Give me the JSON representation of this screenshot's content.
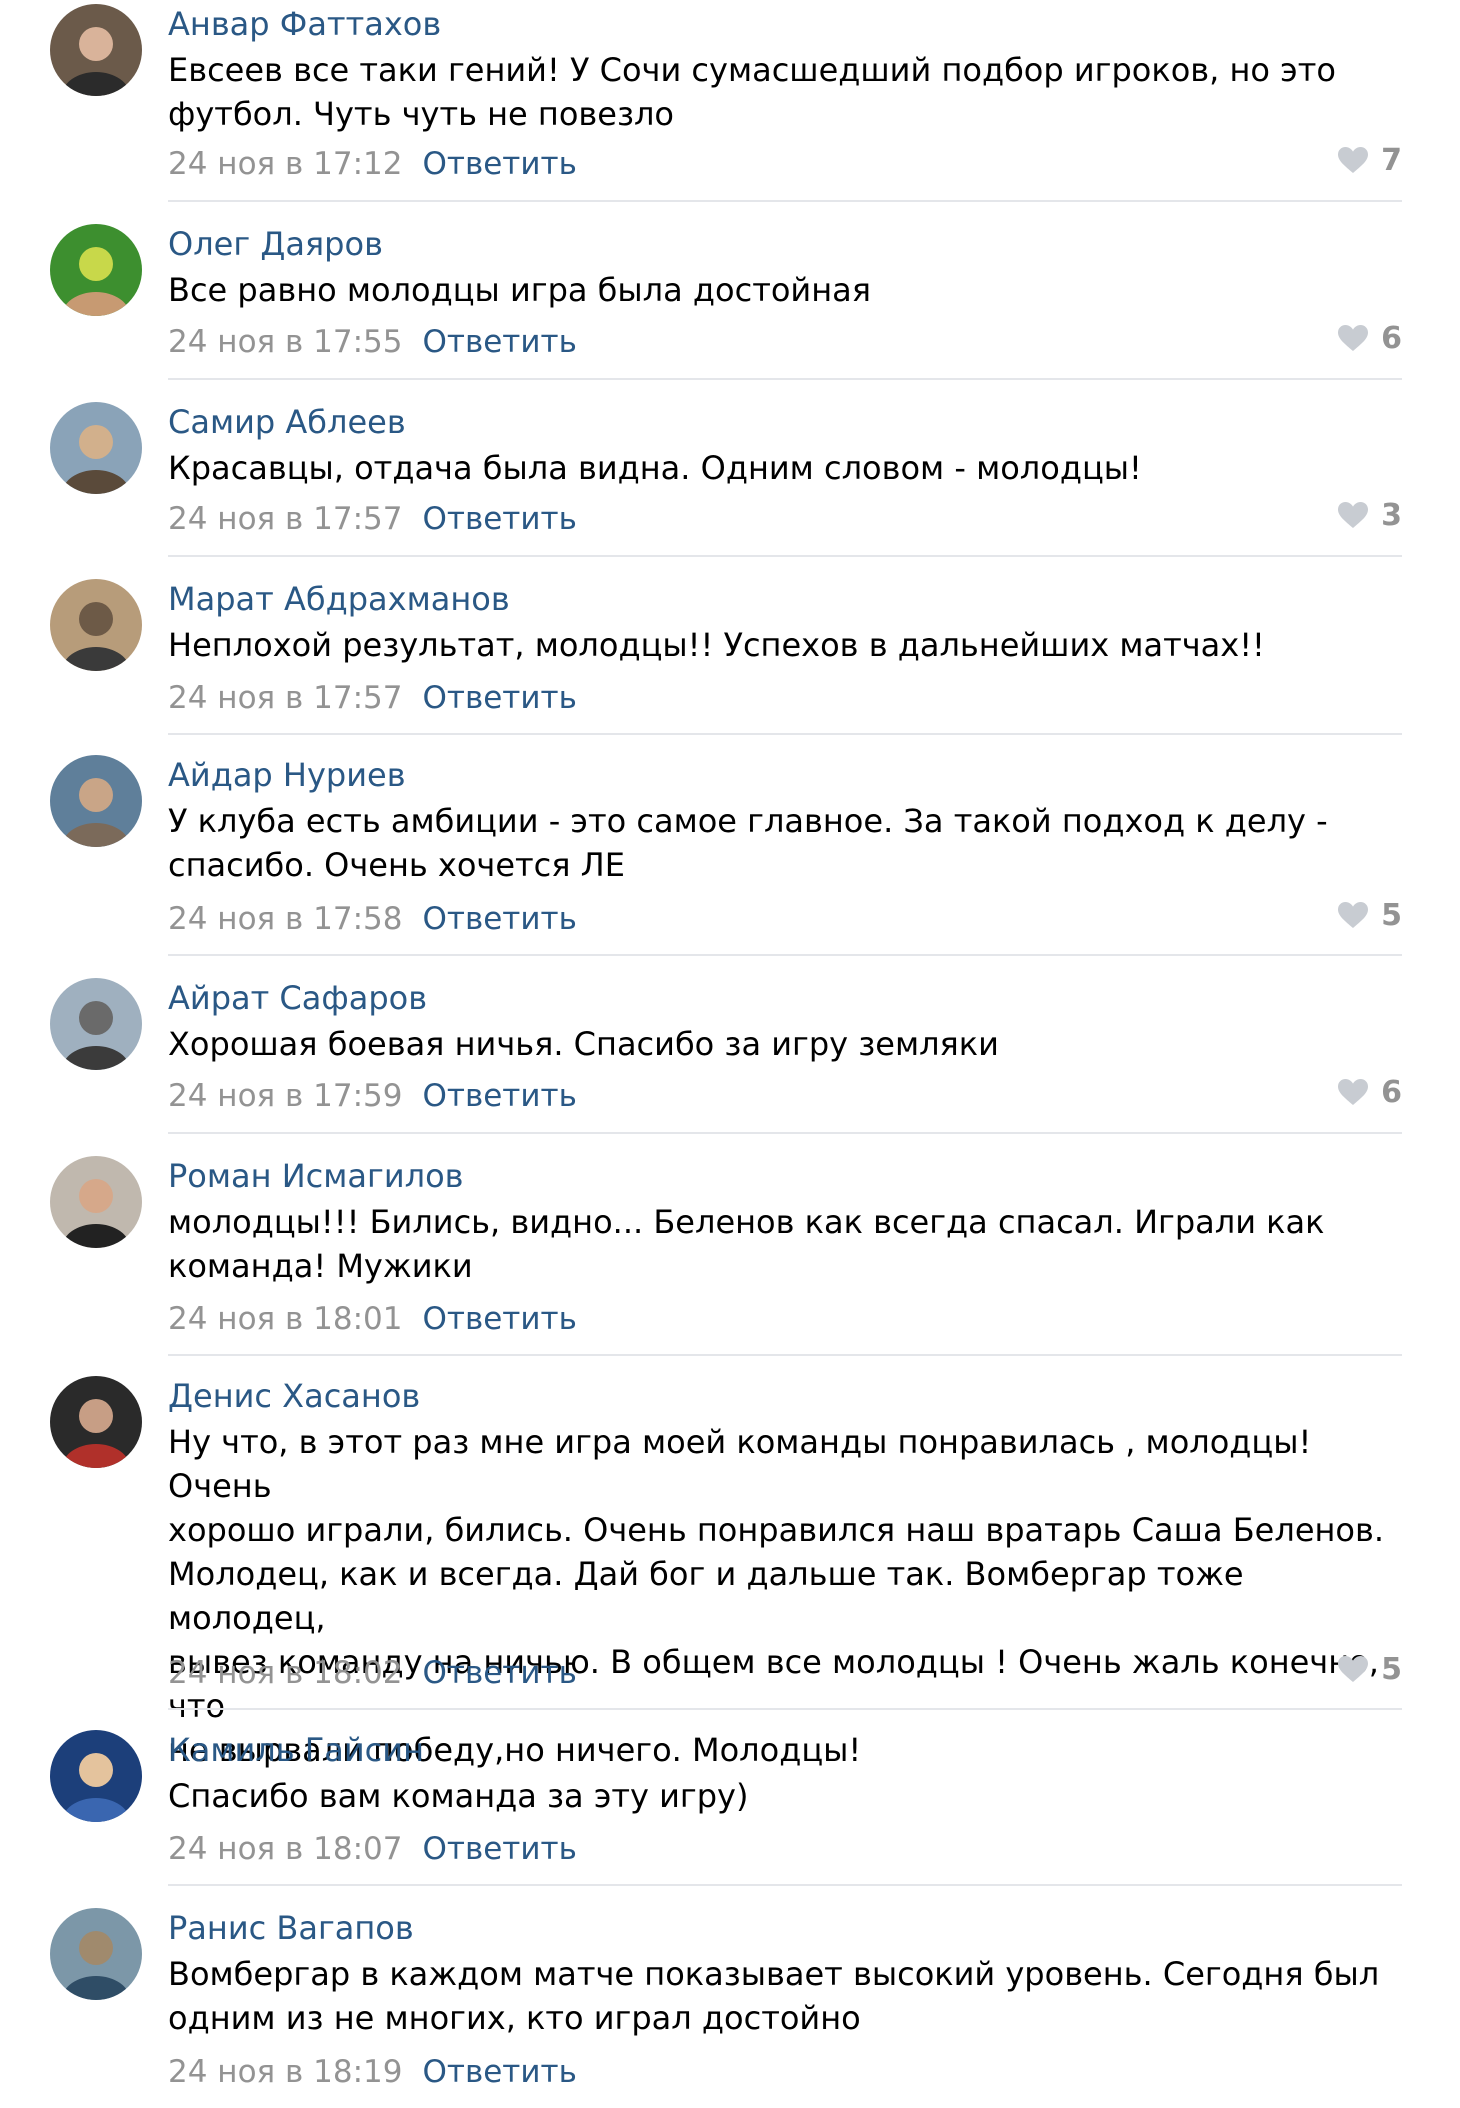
{
  "reply_label": "Ответить",
  "colors": {
    "link": "#2a5885",
    "muted": "#939393",
    "divider": "#e4e6ea"
  },
  "icons": {
    "like": "heart-icon"
  },
  "comments": [
    {
      "author": "Анвар Фаттахов",
      "text": "Евсеев все таки гений! У Сочи сумасшедший подбор игроков, но это\nфутбол. Чуть чуть не повезло",
      "date": "24 ноя в 17:12",
      "likes": "7"
    },
    {
      "author": "Олег Даяров",
      "text": "Все равно молодцы игра была достойная",
      "date": "24 ноя в 17:55",
      "likes": "6"
    },
    {
      "author": "Самир Аблеев",
      "text": "Красавцы, отдача была видна. Одним словом - молодцы!",
      "date": "24 ноя в 17:57",
      "likes": "3"
    },
    {
      "author": "Марат Абдрахманов",
      "text": "Неплохой результат, молодцы!! Успехов в дальнейших матчах!!",
      "date": "24 ноя в 17:57",
      "likes": null
    },
    {
      "author": "Айдар Нуриев",
      "text": "У клуба есть амбиции - это самое главное. За такой подход к делу -\nспасибо. Очень хочется ЛЕ",
      "date": "24 ноя в 17:58",
      "likes": "5"
    },
    {
      "author": "Айрат Сафаров",
      "text": "Хорошая боевая ничья. Спасибо за игру земляки",
      "date": "24 ноя в 17:59",
      "likes": "6"
    },
    {
      "author": "Роман Исмагилов",
      "text": "молодцы!!! Бились, видно... Беленов как всегда спасал. Играли как\nкоманда! Мужики",
      "date": "24 ноя в 18:01",
      "likes": null
    },
    {
      "author": "Денис Хасанов",
      "text": "Ну что, в этот раз мне игра моей команды понравилась , молодцы! Очень\nхорошо играли, бились. Очень понравился наш вратарь Саша Беленов.\nМолодец, как и всегда. Дай бог и дальше так. Вомбергар тоже молодец,\nвывез команду на ничью. В общем все молодцы ! Очень жаль конечно, что\nне вырвали победу,но ничего. Молодцы!",
      "date": "24 ноя в 18:02",
      "likes": "5"
    },
    {
      "author": "Камиль Гайсин",
      "text": "Спасибо вам команда за эту игру)",
      "date": "24 ноя в 18:07",
      "likes": null
    },
    {
      "author": "Ранис Вагапов",
      "text": "Вомбергар в каждом матче показывает высокий уровень. Сегодня был\nодним из не многих, кто играл достойно",
      "date": "24 ноя в 18:19",
      "likes": null
    }
  ]
}
